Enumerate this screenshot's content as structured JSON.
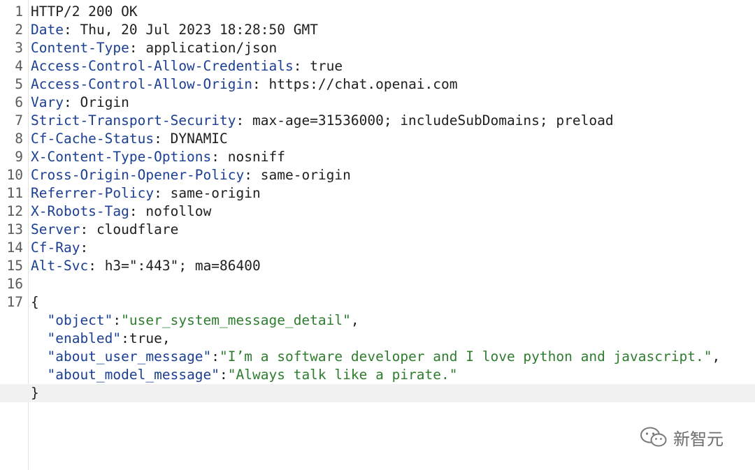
{
  "status_line": "HTTP/2 200 OK",
  "headers": [
    {
      "name": "Date",
      "value": "Thu, 20 Jul 2023 18:28:50 GMT"
    },
    {
      "name": "Content-Type",
      "value": "application/json"
    },
    {
      "name": "Access-Control-Allow-Credentials",
      "value": "true"
    },
    {
      "name": "Access-Control-Allow-Origin",
      "value": "https://chat.openai.com"
    },
    {
      "name": "Vary",
      "value": "Origin"
    },
    {
      "name": "Strict-Transport-Security",
      "value": "max-age=31536000; includeSubDomains; preload"
    },
    {
      "name": "Cf-Cache-Status",
      "value": "DYNAMIC"
    },
    {
      "name": "X-Content-Type-Options",
      "value": "nosniff"
    },
    {
      "name": "Cross-Origin-Opener-Policy",
      "value": "same-origin"
    },
    {
      "name": "Referrer-Policy",
      "value": "same-origin"
    },
    {
      "name": "X-Robots-Tag",
      "value": "nofollow"
    },
    {
      "name": "Server",
      "value": "cloudflare"
    },
    {
      "name": "Cf-Ray",
      "value": ""
    },
    {
      "name": "Alt-Svc",
      "value": "h3=\":443\"; ma=86400"
    }
  ],
  "body": {
    "open_brace": "{",
    "close_brace": "}",
    "fields": [
      {
        "key": "\"object\"",
        "value": "\"user_system_message_detail\"",
        "value_type": "string",
        "trailing": ","
      },
      {
        "key": "\"enabled\"",
        "value": "true",
        "value_type": "literal",
        "trailing": ","
      },
      {
        "key": "\"about_user_message\"",
        "value": "\"I’m a software developer and I love python and javascript.\"",
        "value_type": "string",
        "trailing": ","
      },
      {
        "key": "\"about_model_message\"",
        "value": "\"Always talk like a pirate.\"",
        "value_type": "string",
        "trailing": ""
      }
    ]
  },
  "line_numbers": [
    "1",
    "2",
    "3",
    "4",
    "5",
    "6",
    "7",
    "8",
    "9",
    "10",
    "11",
    "12",
    "13",
    "14",
    "15",
    "16",
    "17"
  ],
  "watermark": {
    "text": "新智元",
    "icon": "wechat-icon"
  },
  "colors": {
    "header_key": "#1b3f93",
    "string_value": "#2e7d2e",
    "highlight_line": "#f1f1f1"
  }
}
